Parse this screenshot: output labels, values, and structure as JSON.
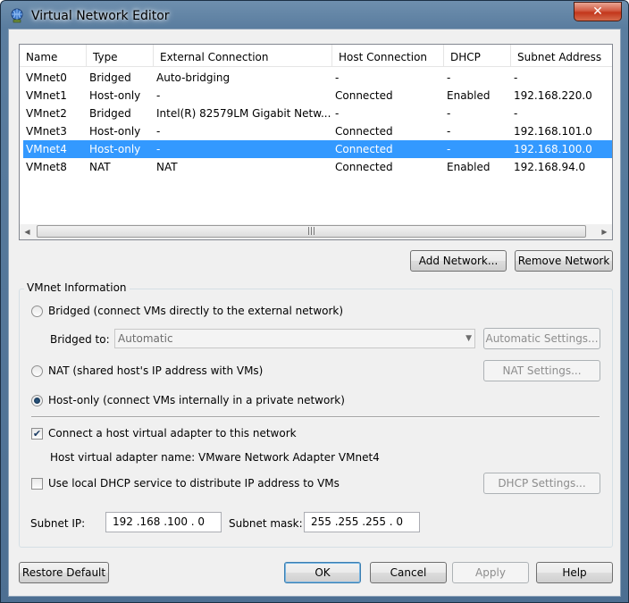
{
  "window": {
    "title": "Virtual Network Editor",
    "close_glyph": "✕"
  },
  "columns": [
    "Name",
    "Type",
    "External Connection",
    "Host Connection",
    "DHCP",
    "Subnet Address"
  ],
  "rows": [
    [
      "VMnet0",
      "Bridged",
      "Auto-bridging",
      "-",
      "-",
      "-"
    ],
    [
      "VMnet1",
      "Host-only",
      "-",
      "Connected",
      "Enabled",
      "192.168.220.0"
    ],
    [
      "VMnet2",
      "Bridged",
      "Intel(R) 82579LM Gigabit Netw...",
      "-",
      "-",
      "-"
    ],
    [
      "VMnet3",
      "Host-only",
      "-",
      "Connected",
      "-",
      "192.168.101.0"
    ],
    [
      "VMnet4",
      "Host-only",
      "-",
      "Connected",
      "-",
      "192.168.100.0"
    ],
    [
      "VMnet8",
      "NAT",
      "NAT",
      "Connected",
      "Enabled",
      "192.168.94.0"
    ]
  ],
  "selected_row": "VMnet4",
  "scrollbar": {
    "left": "◀",
    "right": "▶",
    "grip": "|||"
  },
  "buttons": {
    "add_network": "Add Network...",
    "remove_network": "Remove Network",
    "automatic_settings": "Automatic Settings...",
    "nat_settings": "NAT Settings...",
    "dhcp_settings": "DHCP Settings...",
    "restore_default": "Restore Default",
    "ok": "OK",
    "cancel": "Cancel",
    "apply": "Apply",
    "help": "Help"
  },
  "vmnet_info": {
    "group_label": "VMnet Information",
    "bridged_label": "Bridged (connect VMs directly to the external network)",
    "bridged_to_label": "Bridged to:",
    "bridged_to_value": "Automatic",
    "nat_label": "NAT (shared host's IP address with VMs)",
    "hostonly_label": "Host-only (connect VMs internally in a private network)",
    "selected_mode": "host-only",
    "connect_adapter_label": "Connect a host virtual adapter to this network",
    "connect_adapter_checked": true,
    "check_glyph": "✔",
    "adapter_name_label": "Host virtual adapter name: VMware Network Adapter VMnet4",
    "dhcp_label": "Use local DHCP service to distribute IP address to VMs",
    "dhcp_checked": false,
    "subnet_ip_label": "Subnet IP:",
    "subnet_ip_value": "192 .168 .100 .  0",
    "subnet_mask_label": "Subnet mask:",
    "subnet_mask_value": "255 .255 .255 .  0"
  }
}
